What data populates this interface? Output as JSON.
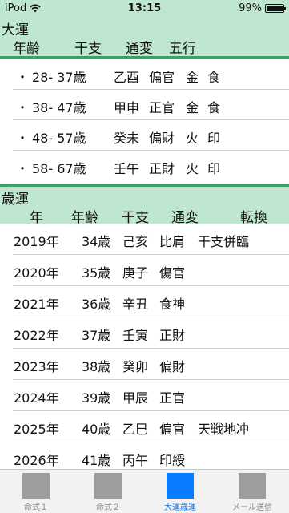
{
  "status": {
    "carrier": "iPod",
    "time": "13:15",
    "battery": "99%"
  },
  "daiun": {
    "title": "大運",
    "headers": [
      "年齢",
      "干支",
      "通変",
      "五行"
    ],
    "rows": [
      {
        "bullet": "・",
        "age": "28- 37歳",
        "kanshi": "乙酉",
        "tsuhen": "偏官",
        "gogyo1": "金",
        "gogyo2": "食"
      },
      {
        "bullet": "・",
        "age": "38- 47歳",
        "kanshi": "甲申",
        "tsuhen": "正官",
        "gogyo1": "金",
        "gogyo2": "食"
      },
      {
        "bullet": "・",
        "age": "48- 57歳",
        "kanshi": "癸未",
        "tsuhen": "偏財",
        "gogyo1": "火",
        "gogyo2": "印"
      },
      {
        "bullet": "・",
        "age": "58- 67歳",
        "kanshi": "壬午",
        "tsuhen": "正財",
        "gogyo1": "火",
        "gogyo2": "印"
      }
    ]
  },
  "saiun": {
    "title": "歳運",
    "headers": [
      "年",
      "年齢",
      "干支",
      "通変",
      "転換"
    ],
    "rows": [
      {
        "year": "2019年",
        "age": "34歳",
        "kanshi": "己亥",
        "tsuhen": "比肩",
        "tenkan": "干支併臨"
      },
      {
        "year": "2020年",
        "age": "35歳",
        "kanshi": "庚子",
        "tsuhen": "傷官",
        "tenkan": ""
      },
      {
        "year": "2021年",
        "age": "36歳",
        "kanshi": "辛丑",
        "tsuhen": "食神",
        "tenkan": ""
      },
      {
        "year": "2022年",
        "age": "37歳",
        "kanshi": "壬寅",
        "tsuhen": "正財",
        "tenkan": ""
      },
      {
        "year": "2023年",
        "age": "38歳",
        "kanshi": "癸卯",
        "tsuhen": "偏財",
        "tenkan": ""
      },
      {
        "year": "2024年",
        "age": "39歳",
        "kanshi": "甲辰",
        "tsuhen": "正官",
        "tenkan": ""
      },
      {
        "year": "2025年",
        "age": "40歳",
        "kanshi": "乙巳",
        "tsuhen": "偏官",
        "tenkan": "天戦地冲"
      },
      {
        "year": "2026年",
        "age": "41歳",
        "kanshi": "丙午",
        "tsuhen": "印綬",
        "tenkan": ""
      }
    ]
  },
  "tabs": [
    {
      "label": "命式１",
      "active": false
    },
    {
      "label": "命式２",
      "active": false
    },
    {
      "label": "大運歳運",
      "active": true
    },
    {
      "label": "メール送信",
      "active": false
    }
  ],
  "colors": {
    "header_bg": "#bfe6cf",
    "header_border": "#3f9e6e",
    "tab_active": "#0a7cff",
    "tab_inactive": "#9d9d9d"
  }
}
